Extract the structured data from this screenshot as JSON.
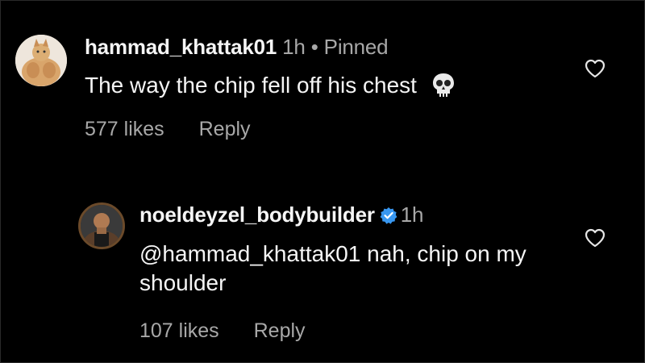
{
  "comments": [
    {
      "username": "hammad_khattak01",
      "time": "1h",
      "separator": "•",
      "pinned_label": "Pinned",
      "text": "The way the chip fell off his chest",
      "emoji_icon": "skull-icon",
      "likes": "577 likes",
      "reply_label": "Reply"
    },
    {
      "username": "noeldeyzel_bodybuilder",
      "verified": true,
      "time": "1h",
      "text_line1": "@hammad_khattak01 nah, chip on my",
      "text_line2": "shoulder",
      "likes": "107 likes",
      "reply_label": "Reply"
    }
  ],
  "colors": {
    "background": "#000000",
    "text_primary": "#f5f5f5",
    "text_secondary": "#a8a8a8",
    "verified_blue": "#3897f0"
  }
}
